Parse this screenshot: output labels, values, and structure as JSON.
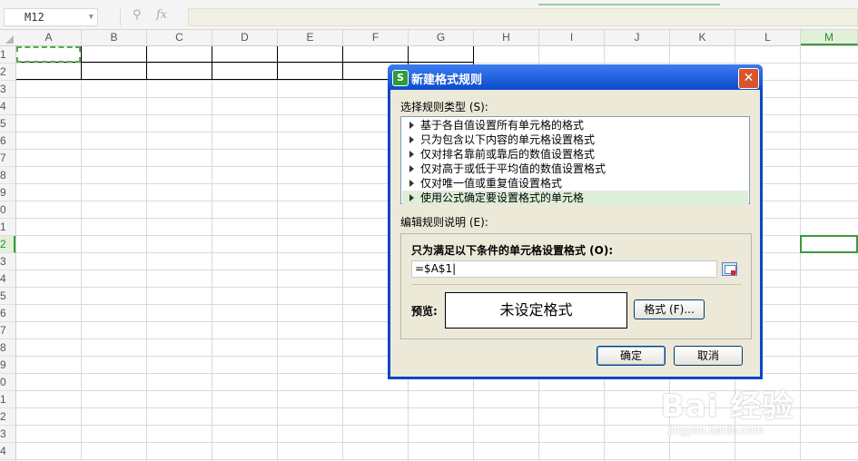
{
  "toolbar": {
    "name_box": "M12",
    "zoom_icon": "search-zoom-icon",
    "fx_label": "fx",
    "formula": ""
  },
  "sheet": {
    "columns": [
      "A",
      "B",
      "C",
      "D",
      "E",
      "F",
      "G",
      "H",
      "I",
      "J",
      "K",
      "L",
      "M"
    ],
    "active_column": "M",
    "rows": [
      "1",
      "2",
      "3",
      "4",
      "5",
      "6",
      "7",
      "8",
      "9",
      "0",
      "1",
      "2",
      "3",
      "4",
      "5",
      "6",
      "7",
      "8",
      "9",
      "0",
      "1",
      "2",
      "3",
      "4"
    ],
    "active_row_index": 11
  },
  "dialog": {
    "title": "新建格式规则",
    "close_label": "✕",
    "app_icon_label": "S",
    "rule_type_label": "选择规则类型 (S):",
    "rule_types": [
      "基于各自值设置所有单元格的格式",
      "只为包含以下内容的单元格设置格式",
      "仅对排名靠前或靠后的数值设置格式",
      "仅对高于或低于平均值的数值设置格式",
      "仅对唯一值或重复值设置格式",
      "使用公式确定要设置格式的单元格"
    ],
    "selected_rule_index": 5,
    "edit_desc_label": "编辑规则说明 (E):",
    "condition_label": "只为满足以下条件的单元格设置格式 (O):",
    "formula_value": "=$A$1|",
    "preview_label": "预览:",
    "preview_text": "未设定格式",
    "format_button": "格式 (F)...",
    "ok_button": "确定",
    "cancel_button": "取消"
  },
  "watermark": {
    "main": "Bai 经验",
    "sub": "jingyan.baidu.com"
  },
  "colors": {
    "accent_green": "#3a9a3a",
    "dialog_blue": "#0c4bcc",
    "close_red": "#d8542d"
  }
}
